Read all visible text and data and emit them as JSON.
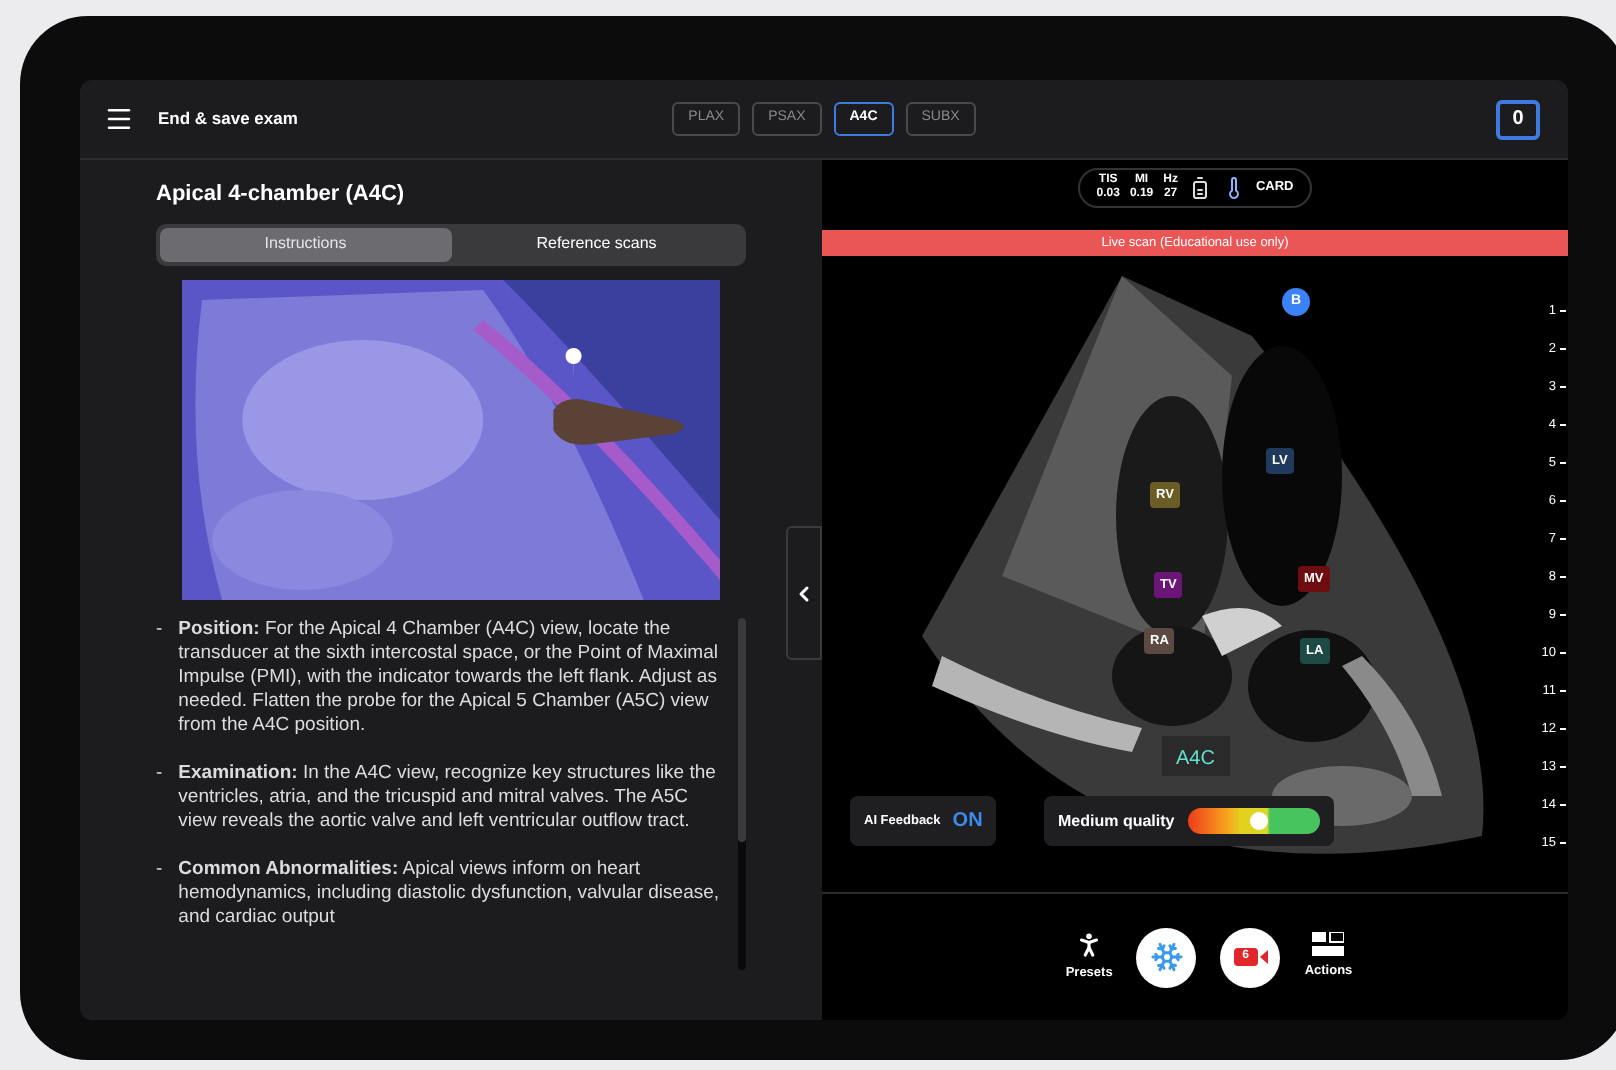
{
  "header": {
    "title": "End & save exam",
    "views": [
      {
        "label": "PLAX",
        "selected": false
      },
      {
        "label": "PSAX",
        "selected": false
      },
      {
        "label": "A4C",
        "selected": true
      },
      {
        "label": "SUBX",
        "selected": false
      }
    ],
    "counter": "0"
  },
  "guide": {
    "title": "Apical 4-chamber (A4C)",
    "tabs": [
      {
        "label": "Instructions",
        "selected": true
      },
      {
        "label": "Reference scans",
        "selected": false
      }
    ],
    "items": [
      {
        "marker": "-",
        "text": "**Position:** For the Apical 4 Chamber (A4C) view, locate the transducer at the sixth intercostal space, or the Point of Maximal Impulse (PMI), with the indicator towards the left flank. Adjust as needed. Flatten the probe for the Apical 5 Chamber (A5C) view from the A4C position."
      },
      {
        "marker": "-",
        "text": "**Examination:** In the A4C view, recognize key structures like the ventricles, atria, and the tricuspid and mitral valves. The A5C view reveals the aortic valve and left ventricular outflow tract."
      },
      {
        "marker": "-",
        "text": "**Common Abnormalities:** Apical views inform on heart hemodynamics, including diastolic dysfunction, valvular disease, and cardiac output"
      }
    ]
  },
  "scan": {
    "status": {
      "metrics": [
        {
          "label": "TIS",
          "value": "0.03"
        },
        {
          "label": "MI",
          "value": "0.19"
        },
        {
          "label": "Hz",
          "value": "27"
        }
      ],
      "mode": "CARD"
    },
    "banner": "Live scan (Educational use only)",
    "marker": "B",
    "labels": [
      {
        "text": "LV",
        "color": "#1f3a5c"
      },
      {
        "text": "RV",
        "color": "#6b5b24"
      },
      {
        "text": "TV",
        "color": "#6a1577"
      },
      {
        "text": "MV",
        "color": "#6e0d10"
      },
      {
        "text": "RA",
        "color": "#5c4a42"
      },
      {
        "text": "LA",
        "color": "#1d4a44"
      }
    ],
    "view_label": "A4C",
    "depth": [
      "1",
      "2",
      "3",
      "4",
      "5",
      "6",
      "7",
      "8",
      "9",
      "10",
      "11",
      "12",
      "13",
      "14",
      "15"
    ],
    "ai_feedback": {
      "label": "AI Feedback",
      "value": "ON",
      "on": true
    },
    "quality": {
      "label": "Medium quality",
      "level": 0.53
    }
  },
  "toolbar": [
    {
      "kind": "presets",
      "label": "Presets"
    },
    {
      "kind": "freeze"
    },
    {
      "kind": "record",
      "badge": "6"
    },
    {
      "kind": "actions",
      "label": "Actions"
    }
  ]
}
